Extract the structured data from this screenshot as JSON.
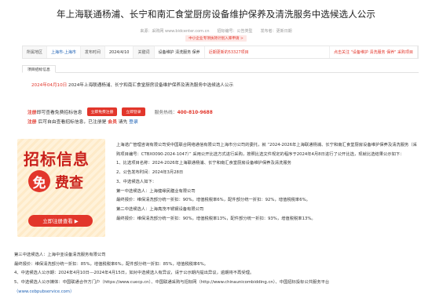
{
  "title": "年上海联通杨浦、长宁和南汇食堂厨房设备维护保养及清洗服务中选候选人公示",
  "meta": {
    "source": "来源：采购网 www.bidcenter.com.cn",
    "category": "招标编号：公告类型",
    "update": "发布者：更新日期"
  },
  "tag": "中小企业专项扶持计划入库申请 >",
  "info": {
    "region_label": "所属地区",
    "region_value": "上海市-上海市",
    "date_label": "发布时间",
    "date_value": "2024/4/10",
    "keyword_label": "关键词",
    "keywords": "设备维护  清洗服务  保养",
    "promo1": "近期更新的53327项目",
    "promo2": "点击关注 \"设备维护 清洗服务 保养\" 采购项目"
  },
  "tab": "项目招标信息",
  "notice": {
    "date": "2024年04月10日",
    "text": "2024年上海联通杨浦、长宁和南汇食堂厨房设备维护保养及清洗服务中选候选人公示"
  },
  "register": {
    "prefix_bold": "注册",
    "prefix_rest": "即可查看免费招标信息",
    "btn_register": "立即免费注册",
    "btn_login": "立即登录",
    "hotline_label": "服务热线：",
    "hotline": "400-810-9688",
    "line2_a": "注册",
    "line2_b": "后可自由查看招标信息，已注册是",
    "line2_vip": "会员",
    "line2_c": "请先",
    "line2_login": "登录"
  },
  "banner": {
    "line1": "招标信息",
    "circle": "免",
    "line2": "费查",
    "button": "立即注册查看 ▶"
  },
  "body": [
    "上海诺广管理咨询有限公司受中国联合网络通信有限公司上海市分公司的委托，就 “2024-2026年上海联通杨浦、长宁和南汇食堂厨房设备维护保养及清洗服务（采购项目编号：CTBX0090-2024-1047）” 采用公开比选方式进行采购，按照比选文件规定的程序于2024年4月8日进行了公开比选，现就比选结果公示如下：",
    "1、比选项目名称：2024-2026年上海联通杨浦、长宁和南汇食堂厨房设备维护保养及清洗服务",
    "2、公告发布时间：2024年3月28日",
    "3、中选候选人如下：",
    "第一中选候选人：上海健缘民膳业有限公司",
    "最终报价：维保清洗部分统一折扣：90%，增值税税率6%，配件部分统一折扣：92%，增值税税率6%。",
    "第二中选候选人：上海亮茂不锈钢设备有限公司",
    "最终报价：维保清洗部分统一折扣：90%，增值税税率13%，配件部分统一折扣：93%，增值税税率13%。"
  ],
  "full": [
    "第三中选候选人：上海中亚设备清洗服务有限公司",
    "最终报价：维保清洗部分统一折扣：85%，增值税税率6%，配件部分统一折扣：85%，增值税税率6%。",
    "4、中选候选人公示期：2024年4月10日---2024年4月15日，如对中选候选人有异议，请于公示期内提出异议，逾期将不再受理。",
    "5、中选候选人公示媒体：中国联通合作方门户（https://www.cuecp.cn）、中国联通采购与招标网（http://www.chinaunicombidding.cn）、中国招标投标公共服务平台"
  ],
  "footer_link": "（www.cebpubservice.com）"
}
